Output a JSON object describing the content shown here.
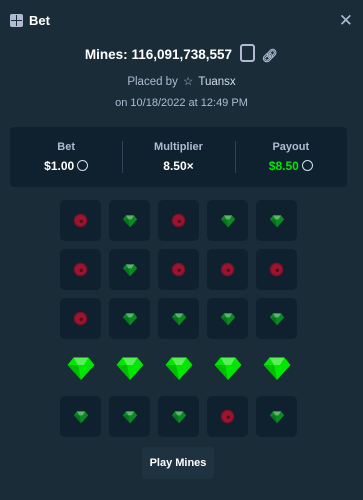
{
  "header": {
    "title": "Bet",
    "close_icon": "close-icon",
    "title_icon": "bet-icon"
  },
  "bet": {
    "mines_label": "Mines:",
    "bet_id": "116,091,738,557",
    "placed_by_label": "Placed by",
    "username": "Tuansx",
    "date_text": "on 10/18/2022 at 12:49 PM"
  },
  "summary": {
    "bet_label": "Bet",
    "bet_value": "$1.00",
    "multiplier_label": "Multiplier",
    "multiplier_value": "8.50×",
    "payout_label": "Payout",
    "payout_value": "$8.50"
  },
  "colors": {
    "payout": "#00e701",
    "gem": "#00e701",
    "mine": "#e9113c",
    "background": "#1a2c38",
    "panel": "#0f212e"
  },
  "grid": {
    "rows": 5,
    "cols": 5,
    "tiles": [
      "mine",
      "gem",
      "mine",
      "gem",
      "gem",
      "mine",
      "gem",
      "mine",
      "mine",
      "mine",
      "mine",
      "gem",
      "gem",
      "gem",
      "gem",
      "gem-revealed",
      "gem-revealed",
      "gem-revealed",
      "gem-revealed",
      "gem-revealed",
      "gem",
      "gem",
      "gem",
      "mine",
      "gem"
    ]
  },
  "play_button": {
    "label": "Play Mines"
  }
}
